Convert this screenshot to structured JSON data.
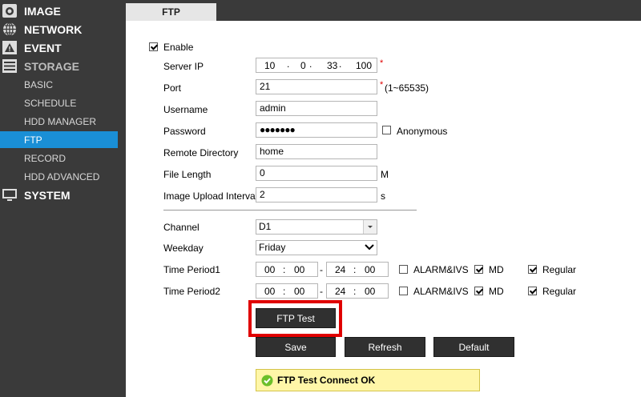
{
  "sidebar": {
    "items": [
      {
        "label": "IMAGE",
        "icon": "camera-icon"
      },
      {
        "label": "NETWORK",
        "icon": "globe-icon"
      },
      {
        "label": "EVENT",
        "icon": "warning-icon"
      },
      {
        "label": "STORAGE",
        "icon": "storage-icon"
      },
      {
        "label": "SYSTEM",
        "icon": "monitor-icon"
      }
    ],
    "sub_items": [
      "BASIC",
      "SCHEDULE",
      "HDD MANAGER",
      "FTP",
      "RECORD",
      "HDD ADVANCED"
    ],
    "active_sub": "FTP"
  },
  "tab": {
    "label": "FTP"
  },
  "form": {
    "enable_label": "Enable",
    "enable_checked": true,
    "server_ip_label": "Server IP",
    "ip": [
      "10",
      "0",
      "33",
      "100"
    ],
    "required_mark": "*",
    "port_label": "Port",
    "port_value": "21",
    "port_range": "(1~65535)",
    "username_label": "Username",
    "username_value": "admin",
    "password_label": "Password",
    "password_value": "●●●●●●●",
    "anonymous_label": "Anonymous",
    "anonymous_checked": false,
    "remote_dir_label": "Remote Directory",
    "remote_dir_value": "home",
    "file_length_label": "File Length",
    "file_length_value": "0",
    "file_length_unit": "M",
    "upload_interval_label": "Image Upload Interval",
    "upload_interval_value": "2",
    "upload_interval_unit": "s",
    "channel_label": "Channel",
    "channel_value": "D1",
    "weekday_label": "Weekday",
    "weekday_value": "Friday",
    "periods": [
      {
        "label": "Time Period1",
        "start_h": "00",
        "start_m": "00",
        "end_h": "24",
        "end_m": "00",
        "alarm_ivs": false,
        "md": true,
        "regular": true
      },
      {
        "label": "Time Period2",
        "start_h": "00",
        "start_m": "00",
        "end_h": "24",
        "end_m": "00",
        "alarm_ivs": false,
        "md": true,
        "regular": true
      }
    ],
    "alarm_ivs_label": "ALARM&IVS",
    "md_label": "MD",
    "regular_label": "Regular",
    "time_sep": ":",
    "range_sep": "-"
  },
  "buttons": {
    "ftp_test": "FTP Test",
    "save": "Save",
    "refresh": "Refresh",
    "default": "Default"
  },
  "status": {
    "text": "FTP Test Connect OK",
    "icon": "check-circle-icon"
  },
  "colors": {
    "active_nav": "#1a8fd6",
    "sidebar_bg": "#3a3a3a",
    "highlight": "#e00000",
    "status_bg": "#fff6a8"
  }
}
